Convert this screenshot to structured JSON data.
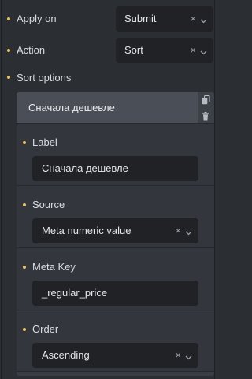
{
  "apply_on": {
    "label": "Apply on",
    "value": "Submit",
    "clear_icon": "×",
    "chevron_icon": "chevron-down-icon"
  },
  "action": {
    "label": "Action",
    "value": "Sort",
    "clear_icon": "×",
    "chevron_icon": "chevron-down-icon"
  },
  "sort_options": {
    "label": "Sort options",
    "item": {
      "title": "Сначала дешевле",
      "copy_icon": "copy-icon",
      "delete_icon": "trash-icon",
      "fields": {
        "label": {
          "label": "Label",
          "value": "Сначала дешевле"
        },
        "source": {
          "label": "Source",
          "value": "Meta numeric value",
          "clear_icon": "×"
        },
        "meta_key": {
          "label": "Meta Key",
          "value": "_regular_price"
        },
        "order": {
          "label": "Order",
          "value": "Ascending",
          "clear_icon": "×"
        }
      }
    }
  },
  "colors": {
    "background": "#2b2e33",
    "input_background": "#202226",
    "accent_dot": "#e8c35a",
    "header_background": "#4a4f57"
  }
}
